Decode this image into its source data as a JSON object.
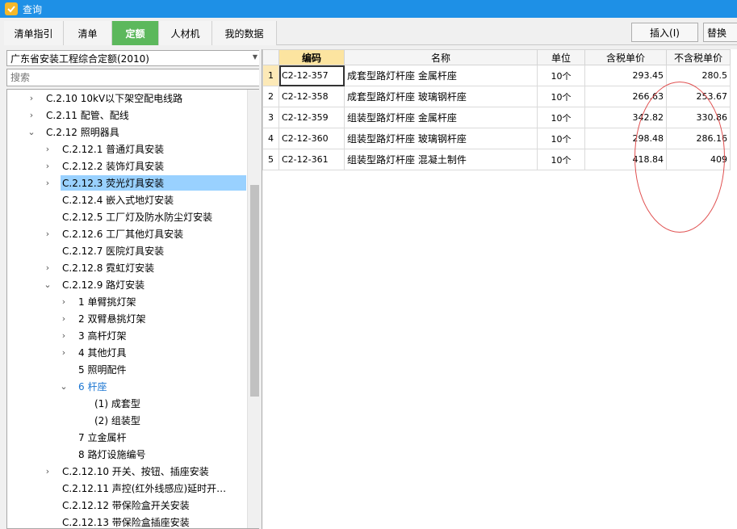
{
  "window": {
    "title": "查询"
  },
  "tabs": [
    {
      "label": "清单指引",
      "active": false
    },
    {
      "label": "清单",
      "active": false
    },
    {
      "label": "定额",
      "active": true
    },
    {
      "label": "人材机",
      "active": false
    },
    {
      "label": "我的数据",
      "active": false
    }
  ],
  "toolbar": {
    "insert_label": "插入(I)",
    "replace_label": "替换"
  },
  "left": {
    "dropdown_value": "广东省安装工程综合定额(2010)",
    "search_placeholder": "搜索",
    "tree": [
      {
        "label": "C.2.10 10kV以下架空配电线路",
        "toggle": "›",
        "level": 1
      },
      {
        "label": "C.2.11 配管、配线",
        "toggle": "›",
        "level": 1
      },
      {
        "label": "C.2.12 照明器具",
        "toggle": "⌄",
        "level": 1
      },
      {
        "label": "C.2.12.1 普通灯具安装",
        "toggle": "›",
        "level": 2
      },
      {
        "label": "C.2.12.2 装饰灯具安装",
        "toggle": "›",
        "level": 2
      },
      {
        "label": "C.2.12.3 荧光灯具安装",
        "toggle": "›",
        "level": 2,
        "selected": true
      },
      {
        "label": "C.2.12.4 嵌入式地灯安装",
        "toggle": "",
        "level": 2
      },
      {
        "label": "C.2.12.5 工厂灯及防水防尘灯安装",
        "toggle": "",
        "level": 2
      },
      {
        "label": "C.2.12.6 工厂其他灯具安装",
        "toggle": "›",
        "level": 2
      },
      {
        "label": "C.2.12.7 医院灯具安装",
        "toggle": "",
        "level": 2
      },
      {
        "label": "C.2.12.8 霓虹灯安装",
        "toggle": "›",
        "level": 2
      },
      {
        "label": "C.2.12.9 路灯安装",
        "toggle": "⌄",
        "level": 2
      },
      {
        "label": "1 单臂挑灯架",
        "toggle": "›",
        "level": 3
      },
      {
        "label": "2 双臂悬挑灯架",
        "toggle": "›",
        "level": 3
      },
      {
        "label": "3 高杆灯架",
        "toggle": "›",
        "level": 3
      },
      {
        "label": "4 其他灯具",
        "toggle": "›",
        "level": 3
      },
      {
        "label": "5 照明配件",
        "toggle": "",
        "level": 3
      },
      {
        "label": "6 杆座",
        "toggle": "⌄",
        "level": 3,
        "blue": true
      },
      {
        "label": "(1) 成套型",
        "toggle": "",
        "level": 4
      },
      {
        "label": "(2) 组装型",
        "toggle": "",
        "level": 4
      },
      {
        "label": "7 立金属杆",
        "toggle": "",
        "level": 3
      },
      {
        "label": "8 路灯设施编号",
        "toggle": "",
        "level": 3
      },
      {
        "label": "C.2.12.10 开关、按钮、插座安装",
        "toggle": "›",
        "level": 2
      },
      {
        "label": "C.2.12.11 声控(红外线感应)延时开…",
        "toggle": "",
        "level": 2
      },
      {
        "label": "C.2.12.12 带保险盒开关安装",
        "toggle": "",
        "level": 2
      },
      {
        "label": "C.2.12.13 带保险盒插座安装",
        "toggle": "",
        "level": 2
      }
    ]
  },
  "grid": {
    "columns": [
      "",
      "编码",
      "名称",
      "单位",
      "含税单价",
      "不含税单价"
    ],
    "rows": [
      {
        "no": "1",
        "code": "C2-12-357",
        "name": "成套型路灯杆座 金属杆座",
        "unit": "10个",
        "tax_price": "293.45",
        "notax_price": "280.5"
      },
      {
        "no": "2",
        "code": "C2-12-358",
        "name": "成套型路灯杆座 玻璃钢杆座",
        "unit": "10个",
        "tax_price": "266.63",
        "notax_price": "253.67"
      },
      {
        "no": "3",
        "code": "C2-12-359",
        "name": "组装型路灯杆座 金属杆座",
        "unit": "10个",
        "tax_price": "342.82",
        "notax_price": "330.86"
      },
      {
        "no": "4",
        "code": "C2-12-360",
        "name": "组装型路灯杆座 玻璃钢杆座",
        "unit": "10个",
        "tax_price": "298.48",
        "notax_price": "286.16"
      },
      {
        "no": "5",
        "code": "C2-12-361",
        "name": "组装型路灯杆座 混凝土制件",
        "unit": "10个",
        "tax_price": "418.84",
        "notax_price": "409"
      }
    ]
  }
}
